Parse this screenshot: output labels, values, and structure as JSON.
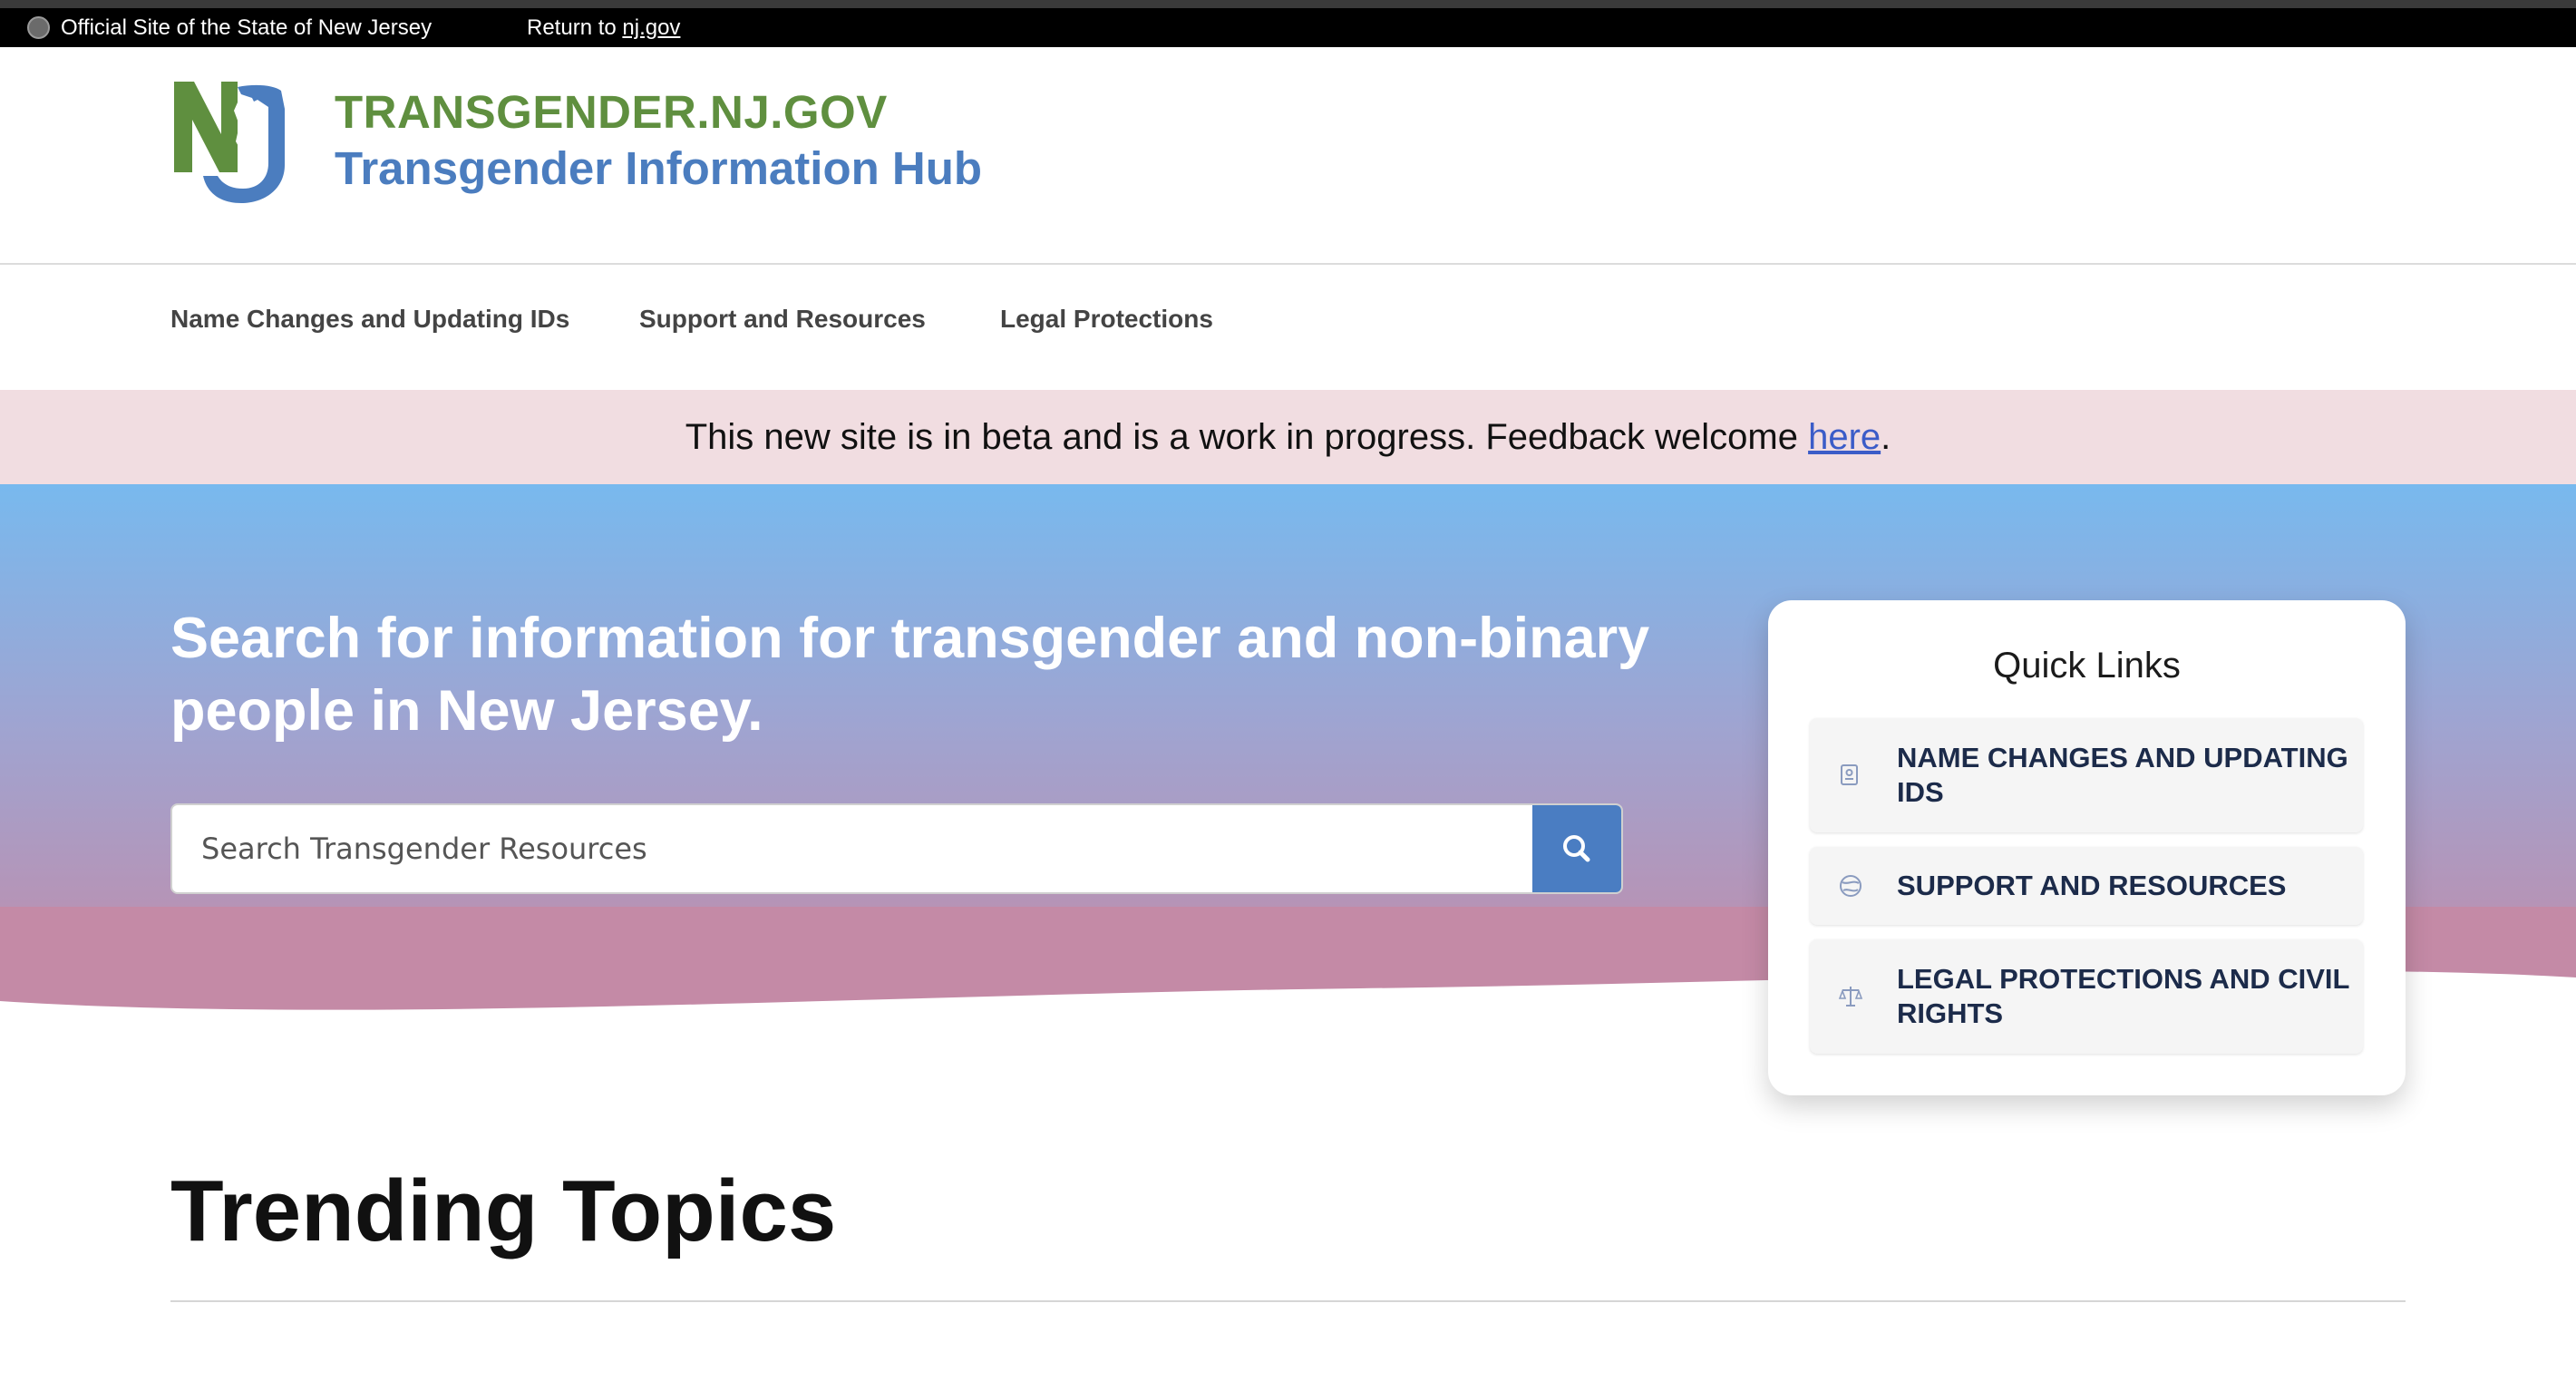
{
  "top_banner": {
    "official": "Official Site of the State of New Jersey",
    "return_prefix": "Return to",
    "return_link": "nj.gov"
  },
  "header": {
    "site_name": "TRANSGENDER.NJ.GOV",
    "subtitle": "Transgender Information Hub"
  },
  "nav": {
    "items": [
      {
        "label": "Name Changes and Updating IDs"
      },
      {
        "label": "Support and Resources"
      },
      {
        "label": "Legal Protections"
      }
    ]
  },
  "beta_banner": {
    "text": "This new site is in beta and is a work in progress. Feedback welcome",
    "link": "here",
    "end": "."
  },
  "hero": {
    "title": "Search for information for transgender and non-binary people in New Jersey.",
    "search_placeholder": "Search Transgender Resources"
  },
  "quick_links": {
    "title": "Quick Links",
    "items": [
      {
        "label": "NAME CHANGES AND UPDATING IDS",
        "icon": "id-card-icon"
      },
      {
        "label": "SUPPORT AND RESOURCES",
        "icon": "globe-icon"
      },
      {
        "label": "LEGAL PROTECTIONS AND CIVIL RIGHTS",
        "icon": "scales-icon"
      }
    ]
  },
  "trending": {
    "title": "Trending Topics"
  },
  "colors": {
    "brand_green": "#5f8f3f",
    "brand_blue": "#4b7dbf",
    "beta_bg": "#f1dde1",
    "search_button": "#4a7dc2"
  }
}
